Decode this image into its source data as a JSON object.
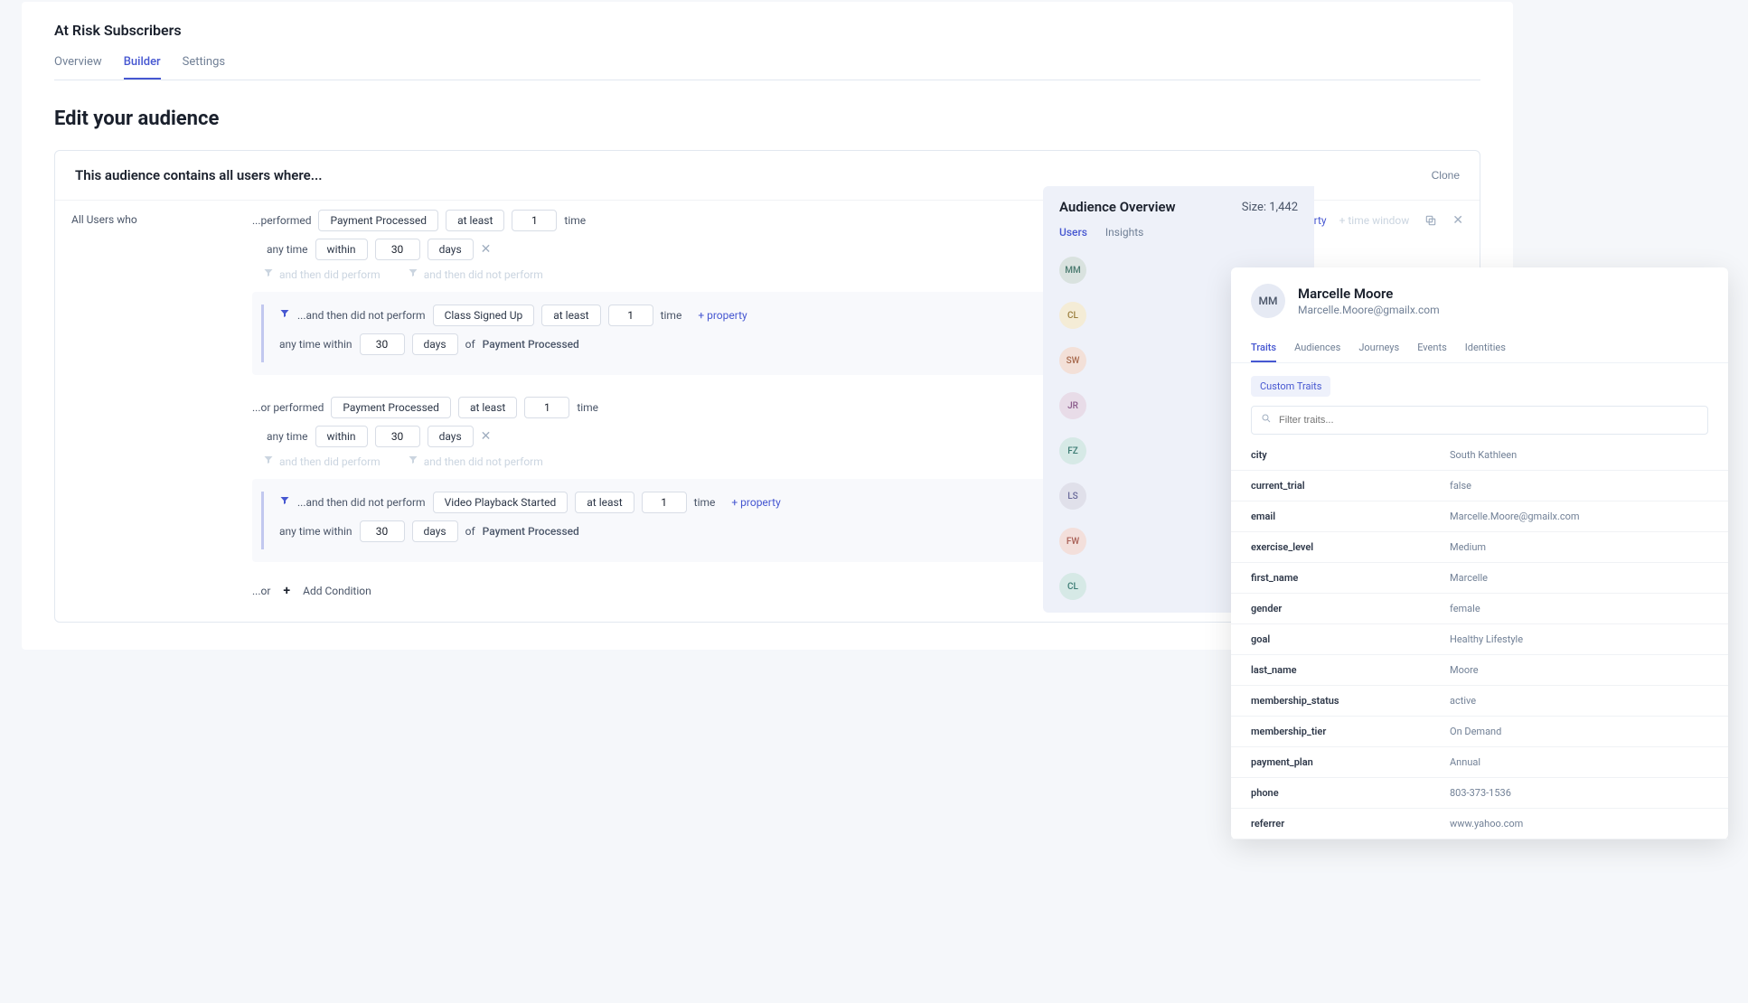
{
  "header": {
    "title": "At Risk Subscribers",
    "tabs": [
      "Overview",
      "Builder",
      "Settings"
    ],
    "active_tab": "Builder"
  },
  "section_title": "Edit your audience",
  "builder": {
    "heading": "This audience contains all users where...",
    "clone": "Clone",
    "all_users": "All Users who",
    "hints": {
      "did_perform": "and then did perform",
      "did_not_perform": "and then did not perform"
    },
    "add_property": "+ property",
    "add_time_window": "+ time window",
    "add_condition": "Add Condition",
    "or_label": "...or",
    "conditions": [
      {
        "prefix": "...performed",
        "event": "Payment Processed",
        "op": "at least",
        "count": "1",
        "time_label": "time",
        "any_time": "any time",
        "within": "within",
        "days_count": "30",
        "days_label": "days"
      },
      {
        "prefix": "...and then did not perform",
        "event": "Class Signed Up",
        "op": "at least",
        "count": "1",
        "time_label": "time",
        "any_time_within": "any time within",
        "days_count": "30",
        "days_label": "days",
        "of_label": "of",
        "of_event": "Payment Processed"
      },
      {
        "prefix": "...or performed",
        "event": "Payment Processed",
        "op": "at least",
        "count": "1",
        "time_label": "time",
        "any_time": "any time",
        "within": "within",
        "days_count": "30",
        "days_label": "days"
      },
      {
        "prefix": "...and then did not perform",
        "event": "Video Playback Started",
        "op": "at least",
        "count": "1",
        "time_label": "time",
        "any_time_within": "any time within",
        "days_count": "30",
        "days_label": "days",
        "of_label": "of",
        "of_event": "Payment Processed"
      }
    ]
  },
  "overview": {
    "title": "Audience Overview",
    "size_label": "Size: 1,442",
    "tabs": [
      "Users",
      "Insights"
    ],
    "active_tab": "Users",
    "avatars": [
      {
        "initials": "MM",
        "bg": "#d9e2df",
        "fg": "#4a7a6f"
      },
      {
        "initials": "CL",
        "bg": "#f4ecd6",
        "fg": "#9a7d3c"
      },
      {
        "initials": "SW",
        "bg": "#f3e0d8",
        "fg": "#a86a4e"
      },
      {
        "initials": "JR",
        "bg": "#e8dce8",
        "fg": "#8a5a8a"
      },
      {
        "initials": "FZ",
        "bg": "#d6e9e6",
        "fg": "#3a7a72"
      },
      {
        "initials": "LS",
        "bg": "#e0e0ea",
        "fg": "#6a6a9a"
      },
      {
        "initials": "FW",
        "bg": "#f3dfdb",
        "fg": "#a85e54"
      },
      {
        "initials": "CL",
        "bg": "#d6e9e6",
        "fg": "#3a7a72"
      }
    ]
  },
  "profile": {
    "avatar_initials": "MM",
    "name": "Marcelle Moore",
    "email": "Marcelle.Moore@gmailx.com",
    "tabs": [
      "Traits",
      "Audiences",
      "Journeys",
      "Events",
      "Identities"
    ],
    "active_tab": "Traits",
    "chip": "Custom Traits",
    "search_placeholder": "Filter traits...",
    "traits": [
      {
        "key": "city",
        "val": "South Kathleen"
      },
      {
        "key": "current_trial",
        "val": "false"
      },
      {
        "key": "email",
        "val": "Marcelle.Moore@gmailx.com"
      },
      {
        "key": "exercise_level",
        "val": "Medium"
      },
      {
        "key": "first_name",
        "val": "Marcelle"
      },
      {
        "key": "gender",
        "val": "female"
      },
      {
        "key": "goal",
        "val": "Healthy Lifestyle"
      },
      {
        "key": "last_name",
        "val": "Moore"
      },
      {
        "key": "membership_status",
        "val": "active"
      },
      {
        "key": "membership_tier",
        "val": "On Demand"
      },
      {
        "key": "payment_plan",
        "val": "Annual"
      },
      {
        "key": "phone",
        "val": "803-373-1536"
      },
      {
        "key": "referrer",
        "val": "www.yahoo.com"
      }
    ]
  }
}
